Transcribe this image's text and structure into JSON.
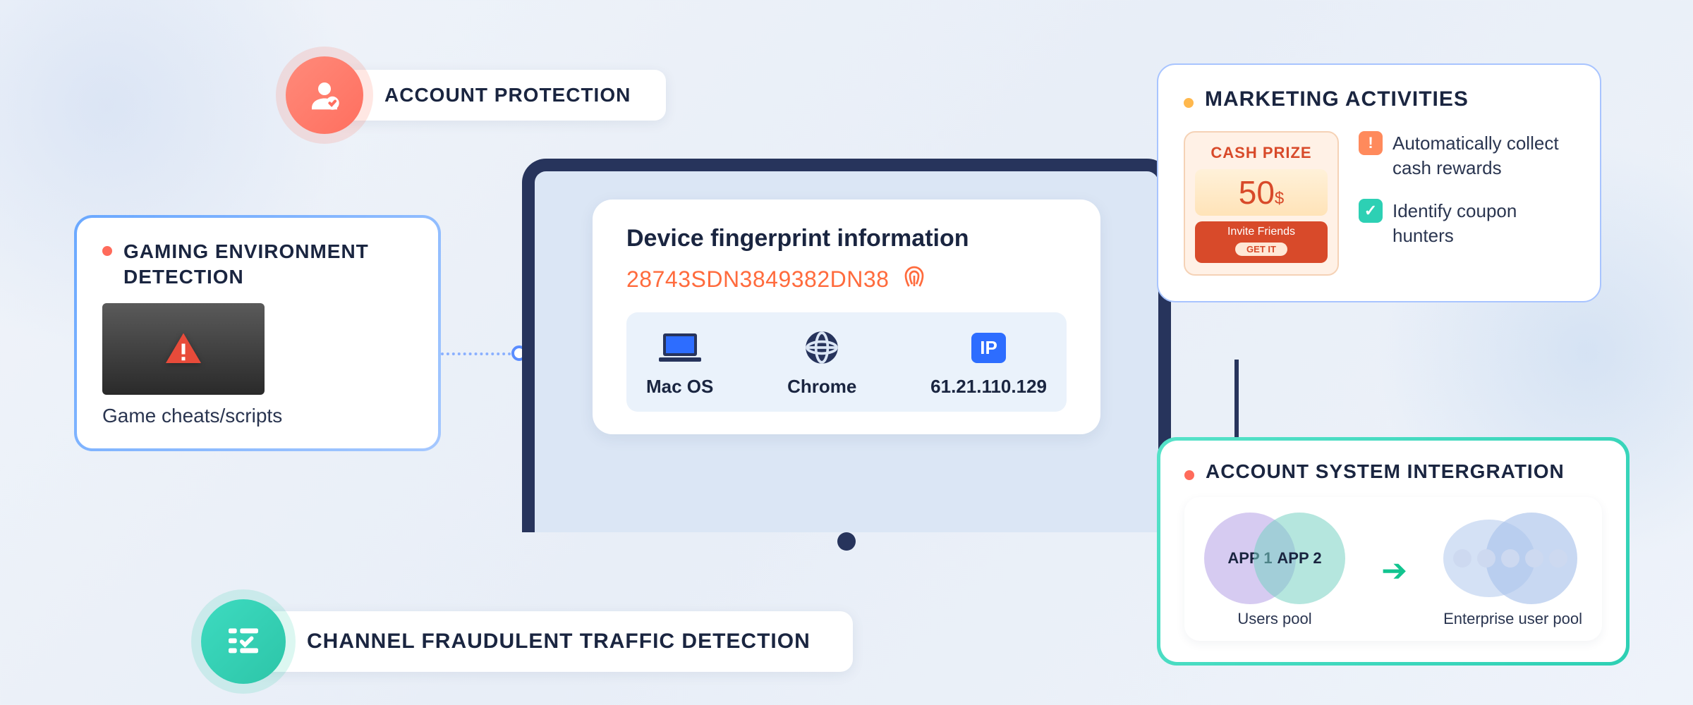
{
  "accountProtection": {
    "label": "ACCOUNT PROTECTION"
  },
  "gaming": {
    "title": "GAMING ENVIRONMENT DETECTION",
    "caption": "Game cheats/scripts"
  },
  "fingerprint": {
    "title": "Device fingerprint information",
    "id": "28743SDN3849382DN38",
    "os": "Mac OS",
    "browser": "Chrome",
    "ipBadge": "IP",
    "ip": "61.21.110.129"
  },
  "channelFraud": {
    "label": "CHANNEL FRAUDULENT TRAFFIC DETECTION"
  },
  "marketing": {
    "title": "MARKETING ACTIVITIES",
    "prize": {
      "heading": "CASH PRIZE",
      "amount": "50",
      "currency": "$",
      "invite": "Invite Friends",
      "cta": "GET IT"
    },
    "bullet1": "Automatically collect cash rewards",
    "bullet2": "Identify coupon hunters"
  },
  "accountIntegration": {
    "title": "ACCOUNT SYSTEM INTERGRATION",
    "app1": "APP 1",
    "app2": "APP 2",
    "usersPool": "Users pool",
    "enterprisePool": "Enterprise user pool"
  }
}
